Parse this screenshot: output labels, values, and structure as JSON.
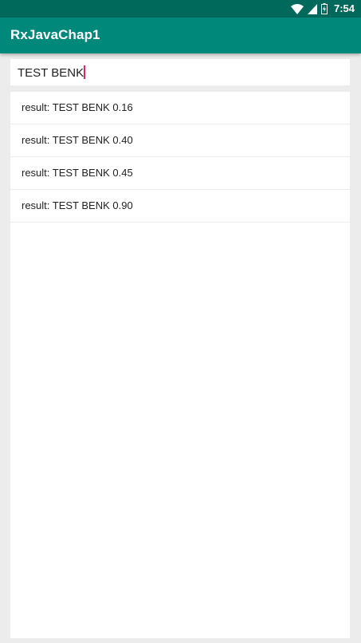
{
  "status_bar": {
    "time": "7:54",
    "icons": [
      "wifi-icon",
      "cell-signal-icon",
      "battery-charging-icon"
    ]
  },
  "app_bar": {
    "title": "RxJavaChap1"
  },
  "search": {
    "value": "TEST BENK"
  },
  "results": [
    "result: TEST BENK 0.16",
    "result: TEST BENK 0.40",
    "result: TEST BENK 0.45",
    "result: TEST BENK 0.90"
  ],
  "colors": {
    "status_bar": "#00695c",
    "app_bar": "#00897b",
    "caret": "#e91e63",
    "background": "#ececec"
  }
}
